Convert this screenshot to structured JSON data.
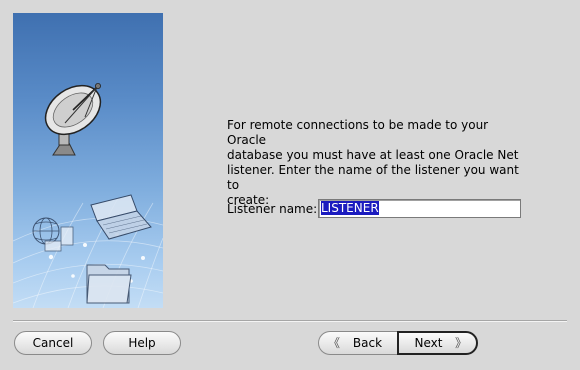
{
  "prompt": {
    "line1": "For remote connections to be made to your Oracle",
    "line2": "database you must have at least one Oracle Net",
    "line3": "listener. Enter the name of the listener you want to",
    "line4": "create:"
  },
  "listener": {
    "label": "Listener name:",
    "value": "LISTENER"
  },
  "buttons": {
    "cancel": "Cancel",
    "help": "Help",
    "back": "Back",
    "next": "Next"
  },
  "icons": {
    "satellite": "satellite-dish-icon",
    "globe": "globe-icon",
    "laptop": "laptop-icon",
    "folder": "folder-icon",
    "back": "double-chevron-left-icon",
    "next": "double-chevron-right-icon"
  }
}
